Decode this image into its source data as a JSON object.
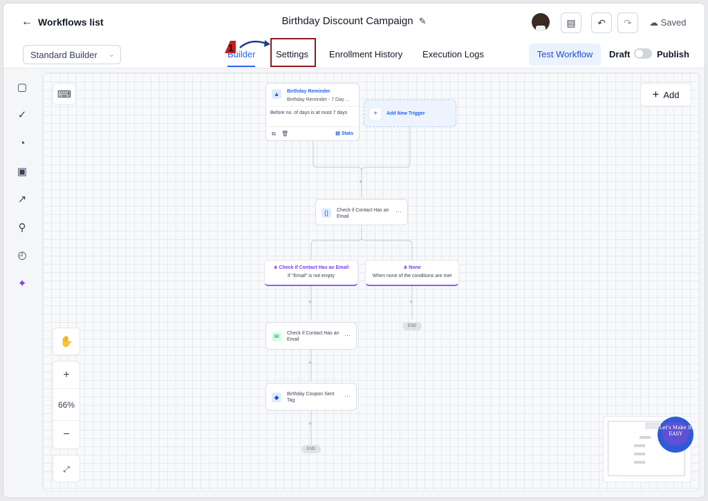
{
  "header": {
    "back_label": "Workflows list",
    "title": "Birthday Discount Campaign",
    "saved_label": "Saved"
  },
  "subbar": {
    "builder_select": "Standard Builder",
    "tabs": [
      {
        "label": "Builder",
        "active": true
      },
      {
        "label": "Settings",
        "active": false
      },
      {
        "label": "Enrollment History",
        "active": false
      },
      {
        "label": "Execution Logs",
        "active": false
      }
    ],
    "test_button": "Test Workflow",
    "draft_label": "Draft",
    "publish_label": "Publish"
  },
  "annotation": {
    "step_number": "1"
  },
  "canvas": {
    "add_label": "Add",
    "trigger": {
      "title": "Birthday Reminder",
      "subtitle": "Birthday Reminder - 7 Day ...",
      "filter": "Before no. of days is at most 7 days",
      "stats_label": "Stats"
    },
    "add_trigger_label": "Add New Trigger",
    "if_node_label": "Check if Contact Has an Email",
    "branches": [
      {
        "title": "Check if Contact Has an Email",
        "subtitle": "If \"Email\" is not empty"
      },
      {
        "title": "None",
        "subtitle": "When none of the conditions are met"
      }
    ],
    "email_node_label": "Check if Contact Has an Email",
    "tag_node_label": "Birthday Coupon Sent Tag",
    "end_label": "END",
    "zoom_level": "66%",
    "badge_text": "Let's Make It EASY"
  },
  "colors": {
    "accent": "#2563eb",
    "condition": "#7c3aed",
    "annotation": "#b91c1c"
  }
}
